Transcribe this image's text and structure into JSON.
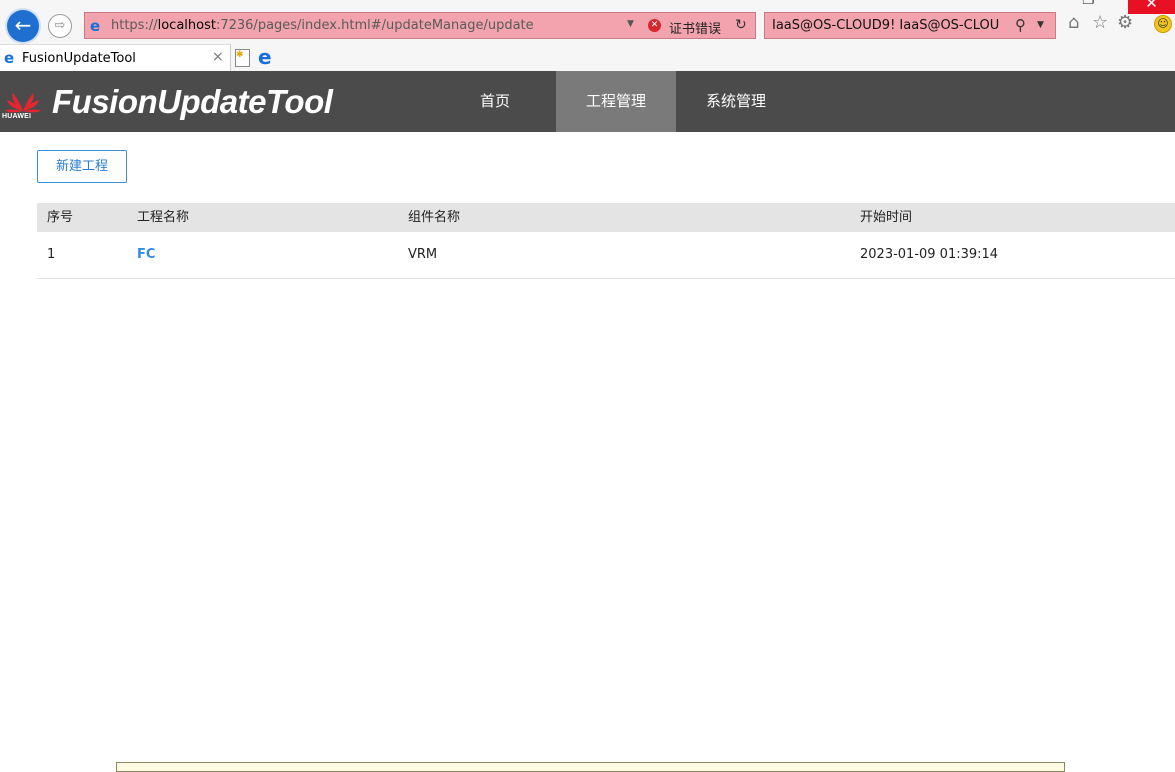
{
  "browser": {
    "url_prefix": "https://",
    "url_host": "localhost",
    "url_rest": ":7236/pages/index.html#/updateManage/update",
    "cert_error": "证书错误",
    "search_text": "IaaS@OS-CLOUD9! IaaS@OS-CLOU",
    "tab_title": "FusionUpdateTool"
  },
  "app": {
    "brand": "HUAWEI",
    "title": "FusionUpdateTool",
    "nav": [
      {
        "label": "首页",
        "active": false
      },
      {
        "label": "工程管理",
        "active": true
      },
      {
        "label": "系统管理",
        "active": false
      }
    ]
  },
  "main": {
    "new_project_label": "新建工程",
    "table": {
      "headers": [
        "序号",
        "工程名称",
        "组件名称",
        "开始时间"
      ],
      "rows": [
        [
          "1",
          "FC",
          "VRM",
          "2023-01-09 01:39:14"
        ]
      ]
    }
  },
  "colors": {
    "header_bg": "#4b4b4b",
    "nav_active_bg": "#7a7a7a",
    "accent": "#2f8ce0",
    "address_error_bg": "#f2a3ad"
  }
}
